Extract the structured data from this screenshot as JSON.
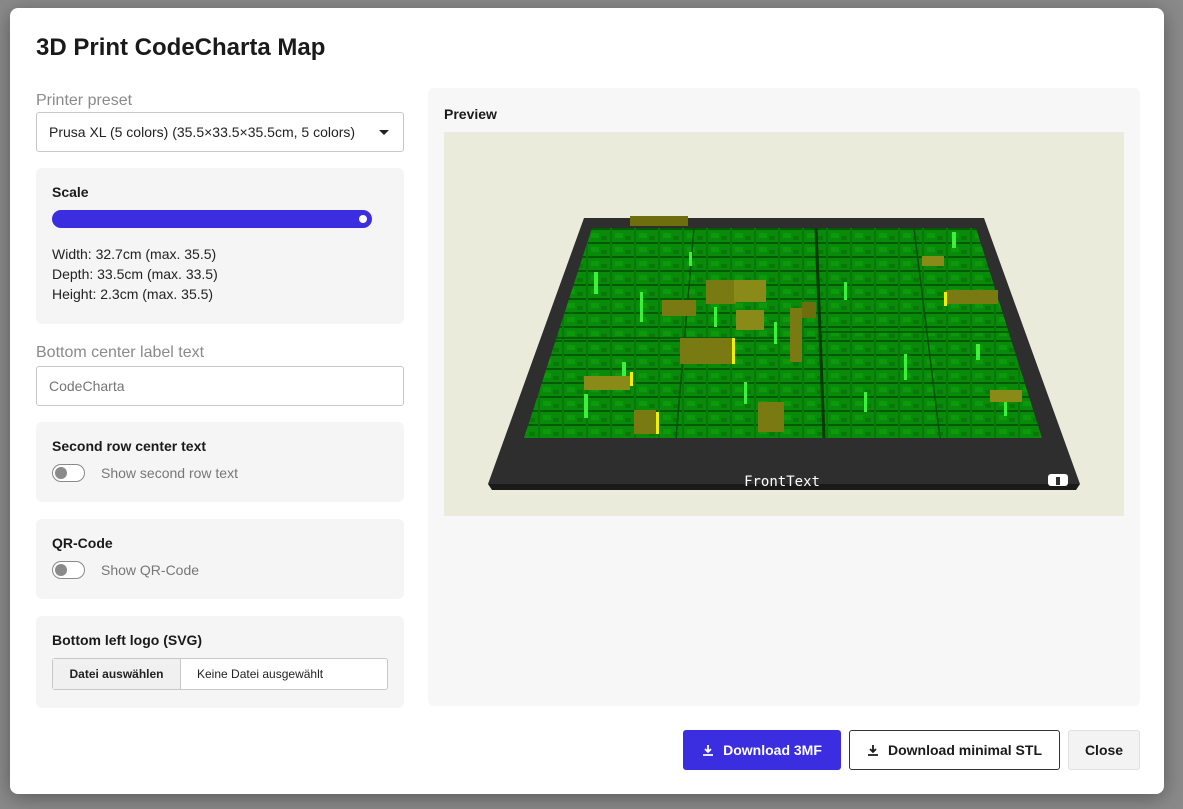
{
  "dialog": {
    "title": "3D Print CodeCharta Map"
  },
  "printer_preset": {
    "label": "Printer preset",
    "selected": "Prusa XL (5 colors) (35.5×33.5×35.5cm, 5 colors)"
  },
  "scale": {
    "title": "Scale",
    "value_fraction": 1.0,
    "width_text": "Width: 32.7cm (max. 35.5)",
    "depth_text": "Depth: 33.5cm (max. 33.5)",
    "height_text": "Height: 2.3cm (max. 35.5)"
  },
  "bottom_label": {
    "label": "Bottom center label text",
    "placeholder": "CodeCharta"
  },
  "second_row": {
    "title": "Second row center text",
    "toggle_label": "Show second row text",
    "enabled": false
  },
  "qr_code": {
    "title": "QR-Code",
    "toggle_label": "Show QR-Code",
    "enabled": false
  },
  "logo": {
    "title": "Bottom left logo (SVG)",
    "choose_button": "Datei auswählen",
    "file_status": "Keine Datei ausgewählt"
  },
  "preview": {
    "title": "Preview",
    "front_text": "FrontText"
  },
  "actions": {
    "download_3mf": "Download 3MF",
    "download_stl": "Download minimal STL",
    "close": "Close"
  },
  "colors": {
    "accent": "#3b2ee0",
    "map_green": "#0a8a0a",
    "map_yellow": "#8a8a10",
    "plate": "#2e2e2e",
    "preview_bg": "#ebebdc"
  }
}
